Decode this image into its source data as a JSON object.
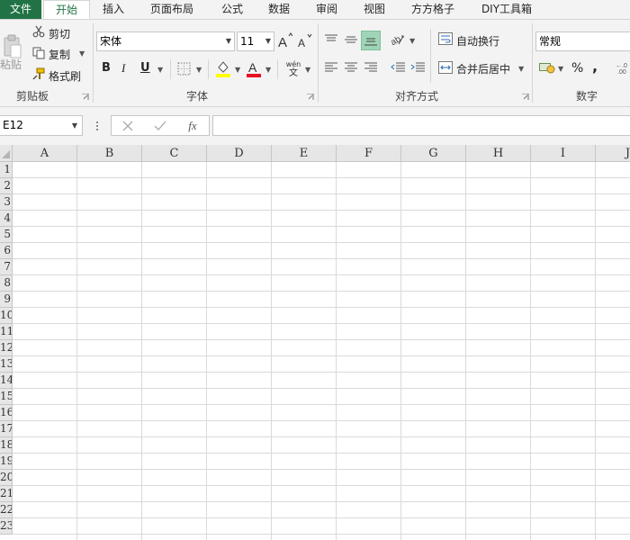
{
  "tabs": [
    {
      "label": "文件",
      "key": "file"
    },
    {
      "label": "开始",
      "key": "home"
    },
    {
      "label": "插入",
      "key": "insert"
    },
    {
      "label": "页面布局",
      "key": "layout"
    },
    {
      "label": "公式",
      "key": "formulas"
    },
    {
      "label": "数据",
      "key": "data"
    },
    {
      "label": "审阅",
      "key": "review"
    },
    {
      "label": "视图",
      "key": "view"
    },
    {
      "label": "方方格子",
      "key": "ffgz"
    },
    {
      "label": "DIY工具箱",
      "key": "diy"
    }
  ],
  "clipboard": {
    "group": "剪贴板",
    "paste": "粘贴",
    "cut": "剪切",
    "copy": "复制",
    "format_painter": "格式刷"
  },
  "font": {
    "group": "字体",
    "name": "宋体",
    "size": "11",
    "bold": "B",
    "italic": "I",
    "underline": "U",
    "wen": "wén",
    "wen_char": "文",
    "font_color": "#e81123",
    "fill_color": "#ffff00"
  },
  "alignment": {
    "group": "对齐方式",
    "wrap": "自动换行",
    "merge": "合并后居中"
  },
  "number": {
    "group": "数字",
    "format": "常规",
    "percent": "%",
    "comma": ","
  },
  "formula_bar": {
    "name_box": "E12",
    "fx": "fx",
    "formula": ""
  },
  "columns": [
    "A",
    "B",
    "C",
    "D",
    "E",
    "F",
    "G",
    "H",
    "I",
    "J"
  ],
  "rows": [
    "1",
    "2",
    "3",
    "4",
    "5",
    "6",
    "7",
    "8",
    "9",
    "10",
    "11",
    "12",
    "13",
    "14",
    "15",
    "16",
    "17",
    "18",
    "19",
    "20",
    "21",
    "22",
    "23"
  ],
  "colors": {
    "accent": "#217346",
    "ribbon_bg": "#f3f3f3",
    "grid_line": "#dadada"
  }
}
